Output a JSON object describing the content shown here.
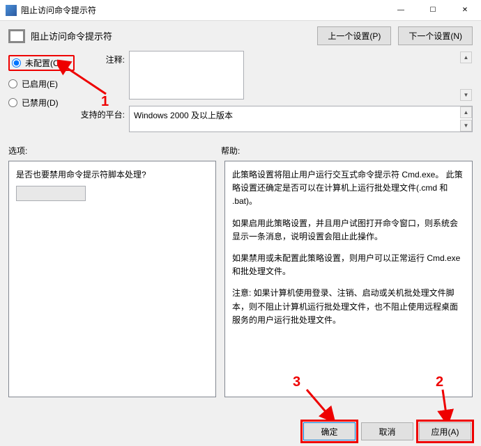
{
  "window": {
    "title": "阻止访问命令提示符",
    "min_label": "—",
    "max_label": "☐",
    "close_label": "✕"
  },
  "header": {
    "subtitle": "阻止访问命令提示符",
    "prev_setting": "上一个设置(P)",
    "next_setting": "下一个设置(N)"
  },
  "radios": {
    "not_configured": "未配置(C)",
    "enabled": "已启用(E)",
    "disabled": "已禁用(D)"
  },
  "fields": {
    "comment_label": "注释:",
    "comment_value": "",
    "platform_label": "支持的平台:",
    "platform_value": "Windows 2000 及以上版本"
  },
  "sections": {
    "options_label": "选项:",
    "help_label": "帮助:"
  },
  "options": {
    "question": "是否也要禁用命令提示符脚本处理?",
    "dropdown_value": ""
  },
  "help": {
    "p1": "此策略设置将阻止用户运行交互式命令提示符 Cmd.exe。 此策略设置还确定是否可以在计算机上运行批处理文件(.cmd 和 .bat)。",
    "p2": "如果启用此策略设置，并且用户试图打开命令窗口，则系统会显示一条消息，说明设置会阻止此操作。",
    "p3": "如果禁用或未配置此策略设置，则用户可以正常运行 Cmd.exe 和批处理文件。",
    "p4": "注意: 如果计算机使用登录、注销、启动或关机批处理文件脚本，则不阻止计算机运行批处理文件，也不阻止使用远程桌面服务的用户运行批处理文件。"
  },
  "footer": {
    "ok": "确定",
    "cancel": "取消",
    "apply": "应用(A)"
  },
  "annotations": {
    "n1": "1",
    "n2": "2",
    "n3": "3"
  }
}
